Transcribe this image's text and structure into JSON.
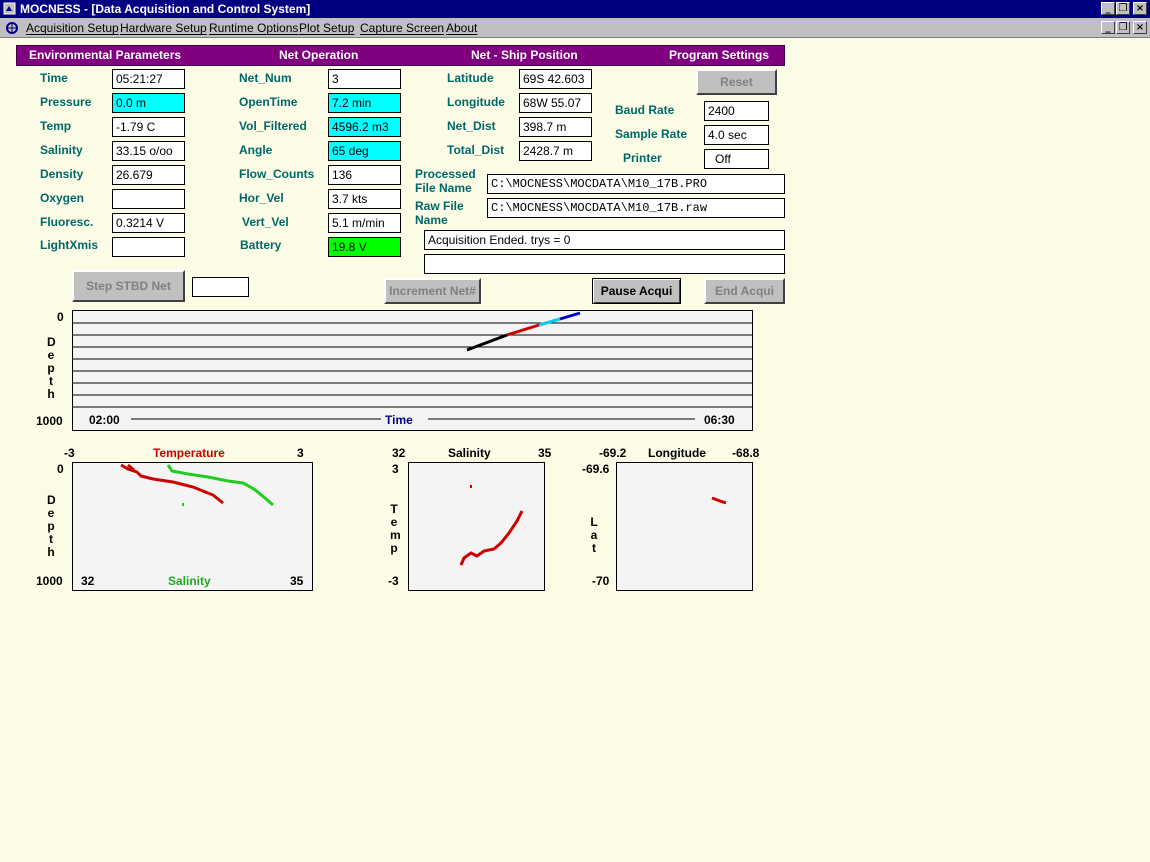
{
  "window": {
    "title": "MOCNESS - [Data Acquisition and Control System]"
  },
  "menu": [
    "Acquisition Setup",
    "Hardware Setup",
    "Runtime Options",
    "Plot Setup",
    "Capture Screen",
    "About"
  ],
  "headers": {
    "env": "Environmental Parameters",
    "net": "Net Operation",
    "pos": "Net - Ship Position",
    "prog": "Program Settings"
  },
  "env": {
    "time": {
      "label": "Time",
      "value": "05:21:27"
    },
    "pressure": {
      "label": "Pressure",
      "value": "0.0 m"
    },
    "temp": {
      "label": "Temp",
      "value": "-1.79 C"
    },
    "salinity": {
      "label": "Salinity",
      "value": "33.15 o/oo"
    },
    "density": {
      "label": "Density",
      "value": "26.679"
    },
    "oxygen": {
      "label": "Oxygen",
      "value": ""
    },
    "fluoresc": {
      "label": "Fluoresc.",
      "value": "0.3214 V"
    },
    "lightxmis": {
      "label": "LightXmis",
      "value": ""
    }
  },
  "net": {
    "net_num": {
      "label": "Net_Num",
      "value": "3"
    },
    "opentime": {
      "label": "OpenTime",
      "value": "7.2 min"
    },
    "vol_filtered": {
      "label": "Vol_Filtered",
      "value": "4596.2 m3"
    },
    "angle": {
      "label": "Angle",
      "value": "65 deg"
    },
    "flow_counts": {
      "label": "Flow_Counts",
      "value": "136"
    },
    "hor_vel": {
      "label": "Hor_Vel",
      "value": "3.7 kts"
    },
    "vert_vel": {
      "label": "Vert_Vel",
      "value": "5.1 m/min"
    },
    "battery": {
      "label": "Battery",
      "value": "19.8 V"
    }
  },
  "pos": {
    "latitude": {
      "label": "Latitude",
      "value": "69S 42.603"
    },
    "longitude": {
      "label": "Longitude",
      "value": "68W 55.07"
    },
    "net_dist": {
      "label": "Net_Dist",
      "value": "398.7 m"
    },
    "total_dist": {
      "label": "Total_Dist",
      "value": "2428.7 m"
    }
  },
  "prog": {
    "reset": "Reset",
    "baud": {
      "label": "Baud Rate",
      "value": "2400"
    },
    "sample": {
      "label": "Sample Rate",
      "value": "4.0 sec"
    },
    "printer": {
      "label": "Printer",
      "value": "Off"
    }
  },
  "files": {
    "processed_label_1": "Processed",
    "processed_label_2": "File Name",
    "processed_value": "C:\\MOCNESS\\MOCDATA\\M10_17B.PRO",
    "raw_label_1": "Raw File",
    "raw_label_2": "Name",
    "raw_value": "C:\\MOCNESS\\MOCDATA\\M10_17B.raw"
  },
  "status": {
    "line1": "Acquisition Ended.  trys = 0",
    "line2": ""
  },
  "buttons": {
    "step": "Step STBD Net",
    "step_value": "",
    "increment": "Increment Net#",
    "pause": "Pause Acqui",
    "end": "End Acqui"
  },
  "depth_plot": {
    "y_top": "0",
    "y_bottom": "1000",
    "y_label": "Depth",
    "x_start": "02:00",
    "x_end": "06:30",
    "x_label": "Time"
  },
  "ts_plot": {
    "temp_min": "-3",
    "temp_label": "Temperature",
    "temp_max": "3",
    "y_top": "0",
    "y_bottom": "1000",
    "y_label": "Depth",
    "sal_min": "32",
    "sal_label": "Salinity",
    "sal_max": "35"
  },
  "st_plot": {
    "x_min": "32",
    "x_label": "Salinity",
    "x_max": "35",
    "y_top": "3",
    "y_bottom": "-3",
    "y_label": "Temp"
  },
  "ll_plot": {
    "x_min": "-69.2",
    "x_label": "Longitude",
    "x_max": "-68.8",
    "y_top": "-69.6",
    "y_bottom": "-70",
    "y_label": "Lat"
  },
  "colors": {
    "header": "#800080",
    "label": "#006868",
    "background": "#fcfce6",
    "temperature": "#cc0000",
    "salinity": "#22cc22",
    "time_label": "#00008b"
  }
}
